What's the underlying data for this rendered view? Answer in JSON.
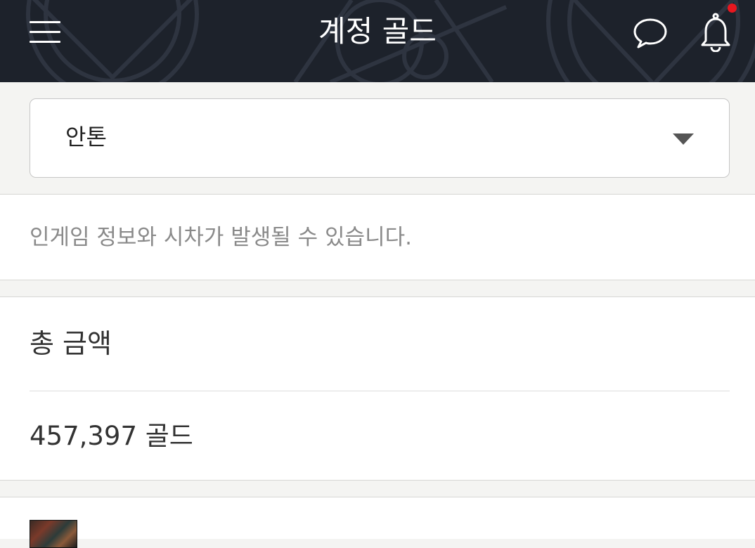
{
  "header": {
    "title": "계정 골드",
    "icons": {
      "menu": "hamburger-menu-icon",
      "chat": "chat-bubble-icon",
      "notifications": "bell-icon"
    },
    "notification_dot_color": "#e8171f"
  },
  "server_select": {
    "selected": "안톤"
  },
  "notice": {
    "text": "인게임 정보와 시차가 발생될 수 있습니다."
  },
  "total": {
    "label": "총 금액",
    "amount": "457,397 골드"
  },
  "colors": {
    "header_bg": "#1d222b",
    "page_bg": "#f4f4f2",
    "card_bg": "#ffffff"
  }
}
